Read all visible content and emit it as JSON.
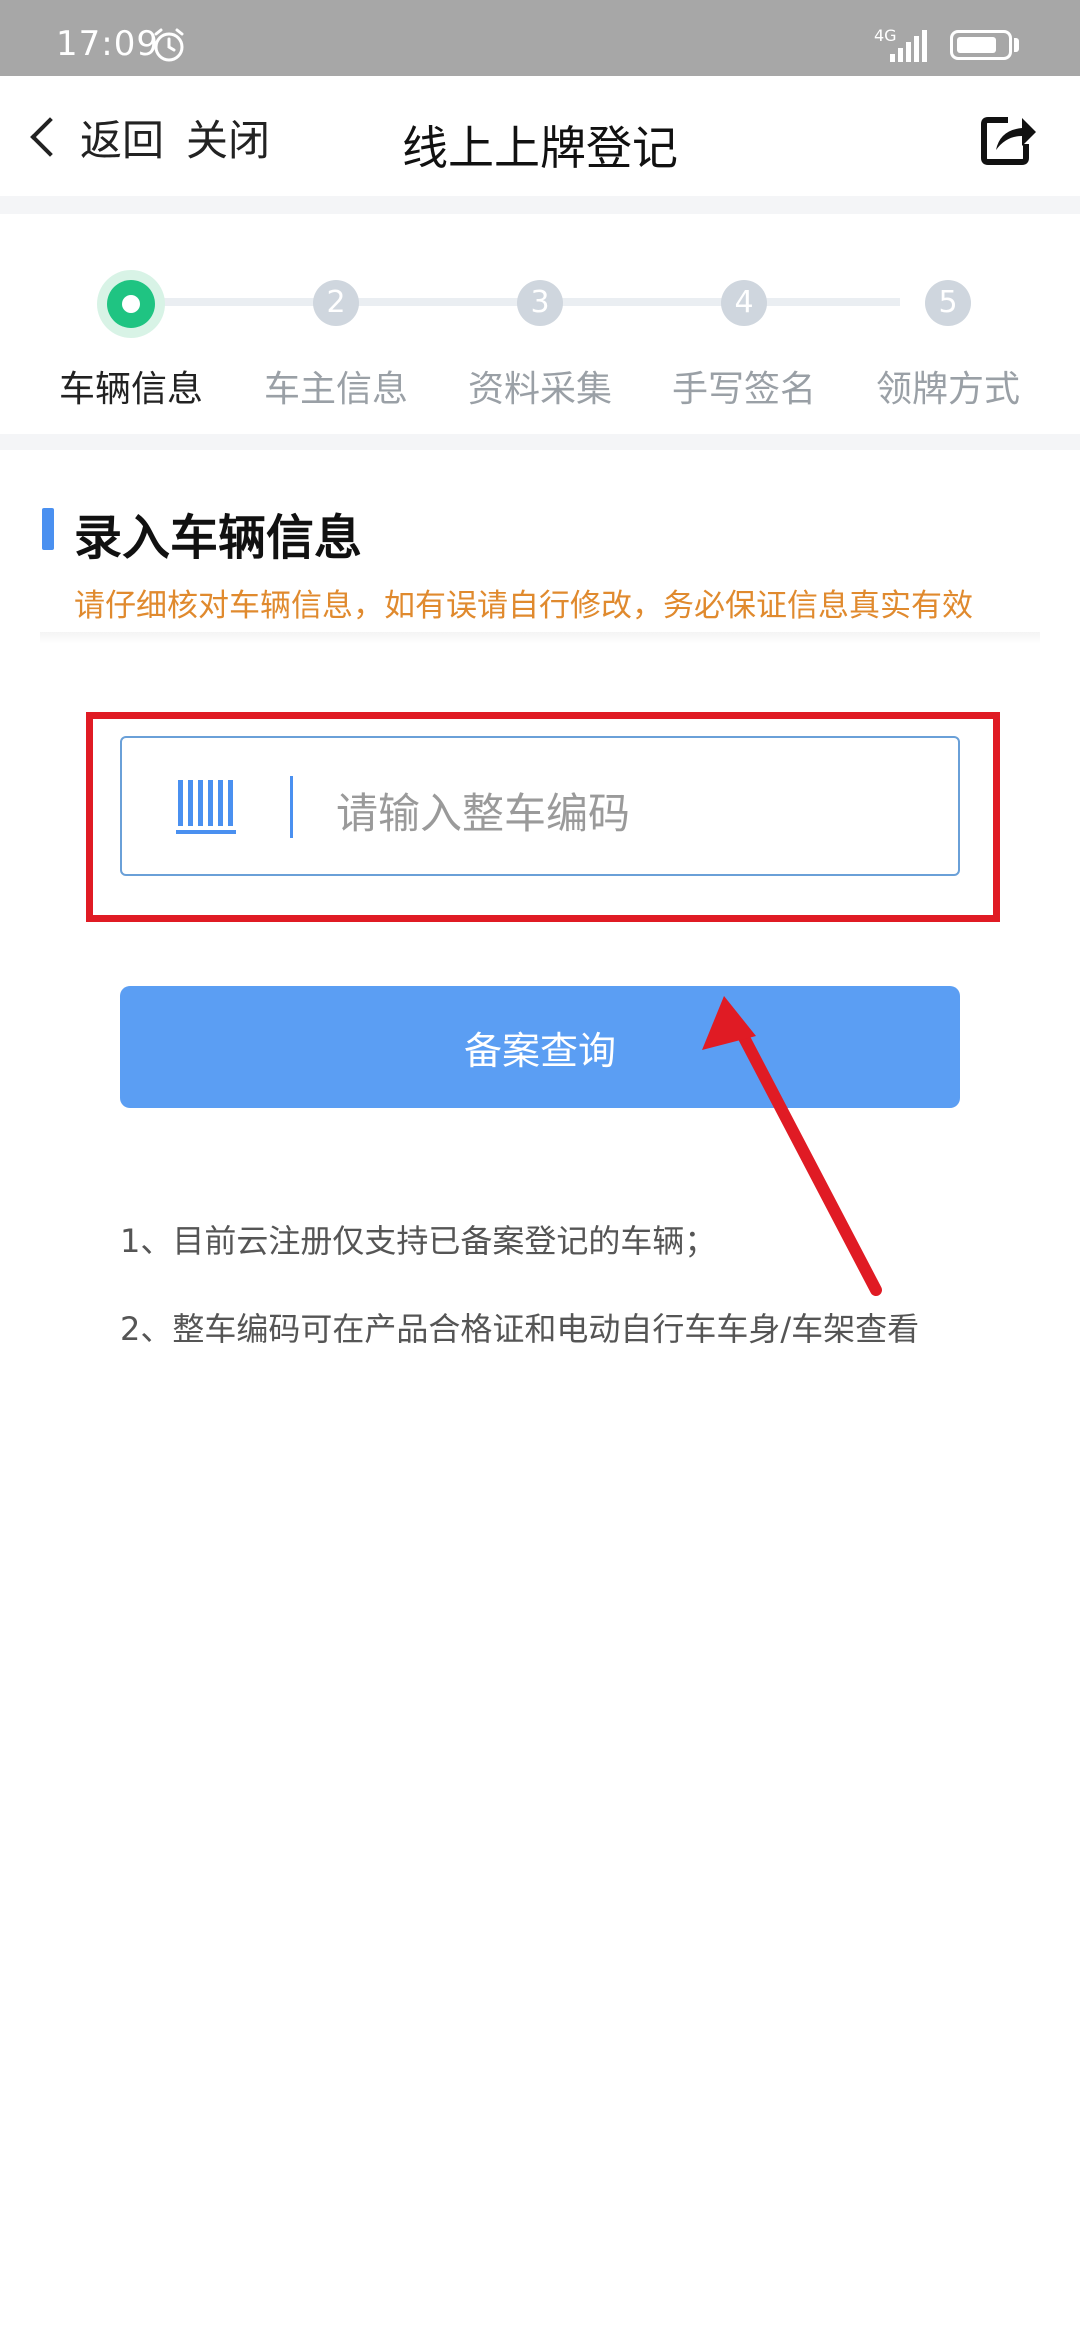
{
  "status_bar": {
    "time": "17:09",
    "network": "4G",
    "alarm_icon": "alarm-clock-icon",
    "battery_icon": "battery-icon",
    "signal_icon": "signal-icon"
  },
  "nav": {
    "back_label": "返回",
    "close_label": "关闭",
    "title": "线上上牌登记",
    "share_icon": "share-icon"
  },
  "steps": [
    {
      "number": "",
      "label": "车辆信息",
      "active": true
    },
    {
      "number": "2",
      "label": "车主信息",
      "active": false
    },
    {
      "number": "3",
      "label": "资料采集",
      "active": false
    },
    {
      "number": "4",
      "label": "手写签名",
      "active": false
    },
    {
      "number": "5",
      "label": "领牌方式",
      "active": false
    }
  ],
  "section": {
    "title": "录入车辆信息",
    "hint": "请仔细核对车辆信息，如有误请自行修改，务必保证信息真实有效"
  },
  "input": {
    "placeholder": "请输入整车编码",
    "value": "",
    "icon": "barcode-icon"
  },
  "button": {
    "label": "备案查询"
  },
  "notes": [
    "1、目前云注册仅支持已备案登记的车辆；",
    "2、整车编码可在产品合格证和电动自行车车身/车架查看"
  ],
  "colors": {
    "accent": "#4a90f0",
    "button": "#5b9ef3",
    "step_active": "#1fc482",
    "hint": "#e08a2e",
    "annotation": "#e01b24"
  }
}
